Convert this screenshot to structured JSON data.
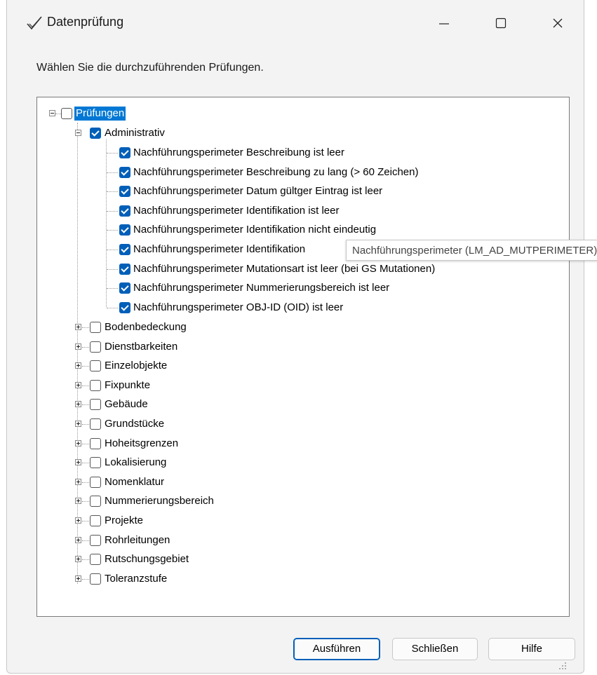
{
  "window": {
    "title": "Datenprüfung",
    "title_icon": "check-icon",
    "controls": {
      "minimize": "minimize-icon",
      "maximize": "maximize-icon",
      "close": "close-icon"
    }
  },
  "instruction": "Wählen Sie die durchzuführenden Prüfungen.",
  "tree": {
    "root": {
      "label": "Prüfungen",
      "checked": false,
      "expanded": true
    },
    "administrativ": {
      "label": "Administrativ",
      "checked": true,
      "expanded": true,
      "items": [
        "Nachführungsperimeter Beschreibung ist leer",
        "Nachführungsperimeter Beschreibung zu lang (> 60 Zeichen)",
        "Nachführungsperimeter Datum gültger Eintrag ist leer",
        "Nachführungsperimeter Identifikation ist leer",
        "Nachführungsperimeter Identifikation nicht eindeutig",
        "Nachführungsperimeter Identifikation",
        "Nachführungsperimeter Mutationsart ist leer (bei GS Mutationen)",
        "Nachführungsperimeter Nummerierungsbereich ist leer",
        "Nachführungsperimeter OBJ-ID (OID) ist leer"
      ]
    },
    "categories": [
      "Bodenbedeckung",
      "Dienstbarkeiten",
      "Einzelobjekte",
      "Fixpunkte",
      "Gebäude",
      "Grundstücke",
      "Hoheitsgrenzen",
      "Lokalisierung",
      "Nomenklatur",
      "Nummerierungsbereich",
      "Projekte",
      "Rohrleitungen",
      "Rutschungsgebiet",
      "Toleranzstufe"
    ]
  },
  "tooltip": "Nachführungsperimeter (LM_AD_MUTPERIMETER)",
  "buttons": {
    "run": "Ausführen",
    "close": "Schließen",
    "help": "Hilfe"
  },
  "colors": {
    "accent": "#005fb8",
    "selection": "#0078d4"
  }
}
